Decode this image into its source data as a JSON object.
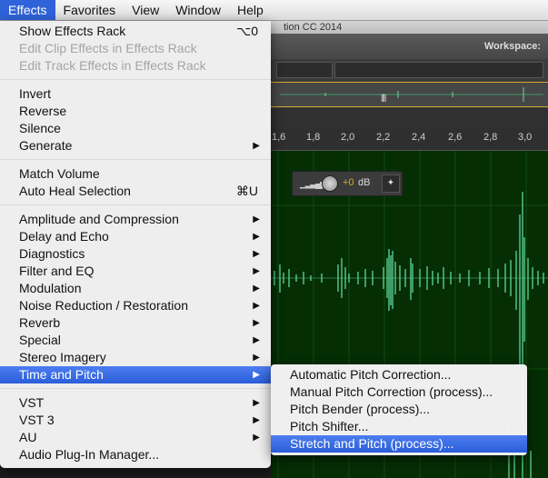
{
  "menubar": [
    "Effects",
    "Favorites",
    "View",
    "Window",
    "Help"
  ],
  "app": {
    "title_fragment": "tion CC 2014",
    "workspace_label": "Workspace:",
    "ruler_ticks": [
      "1,6",
      "1,8",
      "2,0",
      "2,2",
      "2,4",
      "2,6",
      "2,8",
      "3,0"
    ],
    "hud": {
      "value": "+0",
      "unit": "dB"
    }
  },
  "effects_menu": {
    "show_effects_rack": {
      "label": "Show Effects Rack",
      "shortcut": "⌥0"
    },
    "edit_clip_effects": "Edit Clip Effects in Effects Rack",
    "edit_track_effects": "Edit Track Effects in Effects Rack",
    "invert": "Invert",
    "reverse": "Reverse",
    "silence": "Silence",
    "generate": "Generate",
    "match_volume": "Match Volume",
    "auto_heal": {
      "label": "Auto Heal Selection",
      "shortcut": "⌘U"
    },
    "amplitude": "Amplitude and Compression",
    "delay": "Delay and Echo",
    "diagnostics": "Diagnostics",
    "filter": "Filter and EQ",
    "modulation": "Modulation",
    "noise": "Noise Reduction / Restoration",
    "reverb": "Reverb",
    "special": "Special",
    "stereo": "Stereo Imagery",
    "time_pitch": "Time and Pitch",
    "vst": "VST",
    "vst3": "VST 3",
    "au": "AU",
    "plugin_manager": "Audio Plug-In Manager..."
  },
  "submenu": {
    "auto_pitch": "Automatic Pitch Correction...",
    "manual_pitch": "Manual Pitch Correction (process)...",
    "pitch_bender": "Pitch Bender (process)...",
    "pitch_shifter": "Pitch Shifter...",
    "stretch_pitch": "Stretch and Pitch (process)..."
  },
  "icons": {
    "submenu_arrow": "triangle-right-icon",
    "level_meter": "level-bars-icon",
    "volume_knob": "knob-icon",
    "pin": "pin-icon"
  },
  "colors": {
    "menu_highlight": "#2f63d9",
    "waveform": "#5fd79a",
    "waveform_bg": "#052e05",
    "hud_value": "#e0a827"
  }
}
